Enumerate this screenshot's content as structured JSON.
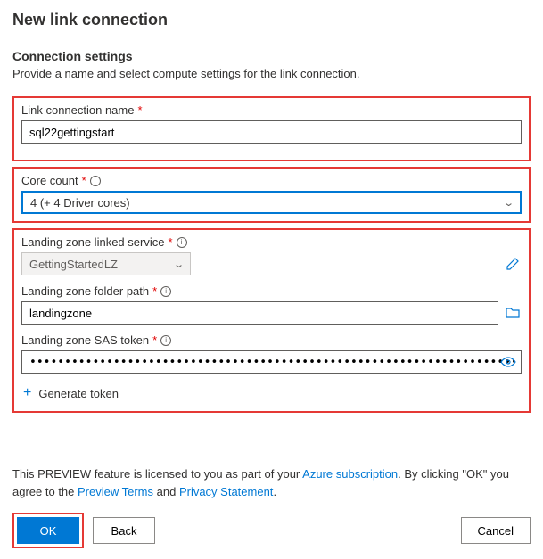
{
  "title": "New link connection",
  "section": {
    "title": "Connection settings",
    "subtitle": "Provide a name and select compute settings for the link connection."
  },
  "fields": {
    "name": {
      "label": "Link connection name",
      "value": "sql22gettingstart"
    },
    "core": {
      "label": "Core count",
      "value": "4 (+ 4 Driver cores)"
    },
    "lz_service": {
      "label": "Landing zone linked service",
      "value": "GettingStartedLZ"
    },
    "lz_path": {
      "label": "Landing zone folder path",
      "value": "landingzone"
    },
    "lz_sas": {
      "label": "Landing zone SAS token",
      "value": "•••••••••••••••••••••••••••••••••••••••••••••••••••••••••••••••••••••••••••••••••••••••••••••••••••••••••••••••••••••••••••••••••••••••••••••••...",
      "generate": "Generate token"
    }
  },
  "preview": {
    "t1": "This PREVIEW feature is licensed to you as part of your ",
    "l1": "Azure subscription",
    "t2": ". By clicking \"OK\" you agree to the ",
    "l2": "Preview Terms",
    "t3": " and ",
    "l3": "Privacy Statement",
    "t4": "."
  },
  "buttons": {
    "ok": "OK",
    "back": "Back",
    "cancel": "Cancel"
  }
}
